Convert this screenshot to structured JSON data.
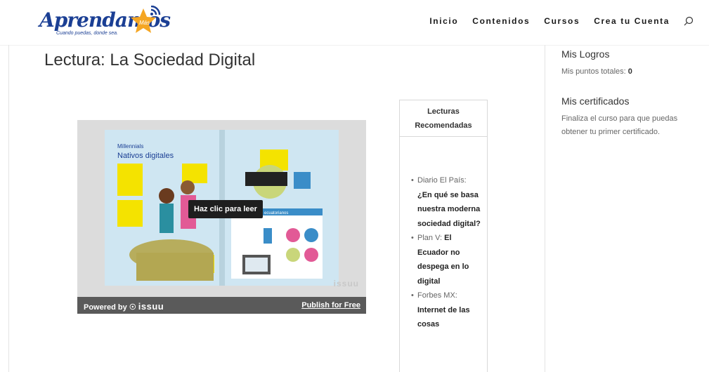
{
  "header": {
    "logo_text": "Aprendamos",
    "logo_tagline": "Cuando puedas, donde sea.",
    "logo_badge": "Más",
    "nav": [
      "Inicio",
      "Contenidos",
      "Cursos",
      "Crea tu Cuenta"
    ]
  },
  "page": {
    "title": "Lectura: La Sociedad Digital"
  },
  "embed": {
    "click_label": "Haz clic para leer",
    "powered_by": "Powered by",
    "issuu": "issuu",
    "publish": "Publish for Free",
    "watermark": "issuu",
    "magazine": {
      "header_small": "Millennials",
      "title": "Nativos digitales",
      "section": "Los Millennials ecuatorianos"
    }
  },
  "readings": {
    "title": "Lecturas Recomendadas",
    "items": [
      {
        "source": "Diario El País:",
        "title": "¿En qué se basa nuestra moderna sociedad digital?"
      },
      {
        "source": "Plan V:",
        "title": "El Ecuador no despega en lo digital"
      },
      {
        "source": "Forbes MX:",
        "title": "Internet de las cosas"
      }
    ]
  },
  "sidebar": {
    "achievements_title": "Mis Logros",
    "points_label": "Mis puntos totales:",
    "points_value": "0",
    "certificates_title": "Mis certificados",
    "certificates_text": "Finaliza el curso para que puedas obtener tu primer certificado."
  },
  "colors": {
    "brand_blue": "#1b3f94",
    "accent_orange": "#f5a623",
    "issuu_bar": "#5a5a5a"
  }
}
